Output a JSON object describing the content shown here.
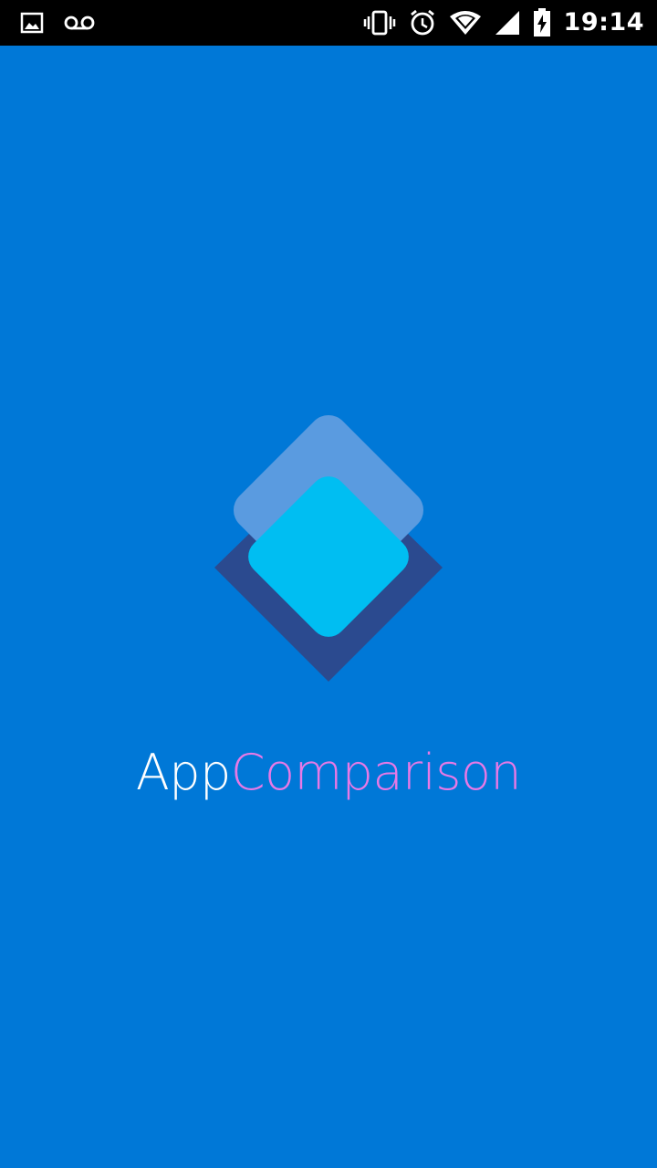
{
  "status_bar": {
    "time": "19:14",
    "left_icons": [
      "image-icon",
      "voicemail-icon"
    ],
    "right_icons": [
      "vibrate-icon",
      "alarm-icon",
      "wifi-icon",
      "signal-icon",
      "battery-charging-icon"
    ]
  },
  "splash": {
    "app_name_part_1": "App",
    "app_name_part_2": "Comparison",
    "colors": {
      "background": "#0078D7",
      "title_part_1": "#FFFFFF",
      "title_part_2": "#E879E6",
      "logo_back": "#2B4A8F",
      "logo_top_frame": "#5A9BE0",
      "logo_front": "#00BEF2"
    }
  }
}
